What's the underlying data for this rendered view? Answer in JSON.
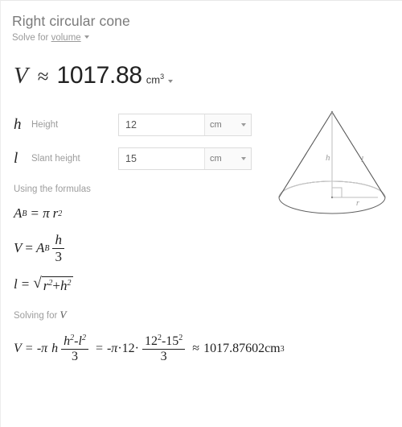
{
  "header": {
    "title": "Right circular cone",
    "solve_prefix": "Solve for",
    "solve_target": "volume",
    "dropdown_icon": "caret-down-icon"
  },
  "result": {
    "symbol": "V",
    "relation": "≈",
    "value": "1017.88",
    "unit": "cm",
    "unit_exponent": "3",
    "dropdown_icon": "caret-down-icon"
  },
  "inputs": [
    {
      "symbol": "h",
      "label": "Height",
      "value": "12",
      "placeholder": "",
      "unit": "cm",
      "unit_icon": "caret-down-icon"
    },
    {
      "symbol": "l",
      "label": "Slant height",
      "value": "15",
      "placeholder": "",
      "unit": "cm",
      "unit_icon": "caret-down-icon"
    }
  ],
  "formulas_section": {
    "heading": "Using the formulas",
    "items": [
      {
        "id": "base-area",
        "lhs_symbol": "A",
        "lhs_sub": "B",
        "eq": "=",
        "pi": "π",
        "radius": "r",
        "radius_exp": "2"
      },
      {
        "id": "volume",
        "lhs_symbol": "V",
        "eq": "=",
        "area_symbol": "A",
        "area_sub": "B",
        "frac_top": "h",
        "frac_bottom": "3"
      },
      {
        "id": "slant",
        "lhs_symbol": "l",
        "eq": "=",
        "radical_sign": "√",
        "term1": "r",
        "term1_exp": "2",
        "plus": "+",
        "term2": "h",
        "term2_exp": "2"
      }
    ]
  },
  "solving_section": {
    "heading_prefix": "Solving for",
    "heading_symbol": "V",
    "equation": {
      "lhs": "V",
      "eq1": "=",
      "neg_pi": "-π",
      "h": "h",
      "frac1_top_a": "h",
      "frac1_top_a_exp": "2",
      "frac1_top_minus": "-",
      "frac1_top_b": "l",
      "frac1_top_b_exp": "2",
      "frac1_bottom": "3",
      "eq2": "=",
      "neg_pi2": "-π",
      "dot1": "·",
      "h_value": "12",
      "dot2": "·",
      "frac2_top_a": "12",
      "frac2_top_a_exp": "2",
      "frac2_top_minus": "-",
      "frac2_top_b": "15",
      "frac2_top_b_exp": "2",
      "frac2_bottom": "3",
      "approx": "≈",
      "final_value": "1017.87602",
      "final_unit": "cm",
      "final_unit_exp": "3"
    }
  },
  "diagram": {
    "name": "right-circular-cone-diagram",
    "labels": {
      "height": "h",
      "slant": "l",
      "radius": "r"
    },
    "colors": {
      "outline": "#555555",
      "guide": "#b8b8b8"
    }
  }
}
